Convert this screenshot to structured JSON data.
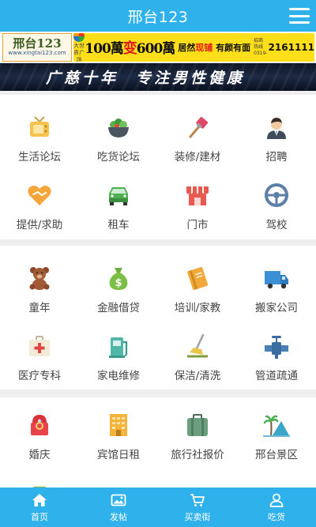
{
  "header": {
    "title": "邢台123",
    "menu_icon": "hamburger-menu-icon"
  },
  "ad_banner_1": {
    "logo_text": "邢台123",
    "logo_url_text": "www.xingtai123.com",
    "brand_text": "大世界广场",
    "slogan_a": "100萬",
    "slogan_b": "变",
    "slogan_c": "600萬",
    "sub_a": "居然",
    "sub_b": "现铺",
    "sub_c": "有颜有面",
    "hotline_label": "招商热线 0319-",
    "phone": "2161111"
  },
  "ad_banner_2": {
    "part1": "广慈十年",
    "part2": "专注男性健康"
  },
  "sections": [
    {
      "items": [
        {
          "label": "生活论坛",
          "icon": "tv-icon"
        },
        {
          "label": "吃货论坛",
          "icon": "salad-bowl-icon"
        },
        {
          "label": "装修/建材",
          "icon": "paint-brush-icon"
        },
        {
          "label": "招聘",
          "icon": "businessman-icon"
        },
        {
          "label": "提供/求助",
          "icon": "handshake-heart-icon"
        },
        {
          "label": "租车",
          "icon": "car-icon"
        },
        {
          "label": "门市",
          "icon": "storefront-icon"
        },
        {
          "label": "驾校",
          "icon": "steering-wheel-icon"
        }
      ]
    },
    {
      "items": [
        {
          "label": "童年",
          "icon": "teddy-bear-icon"
        },
        {
          "label": "金融借贷",
          "icon": "money-bag-icon"
        },
        {
          "label": "培训/家教",
          "icon": "notebook-icon"
        },
        {
          "label": "搬家公司",
          "icon": "truck-icon"
        },
        {
          "label": "医疗专科",
          "icon": "first-aid-kit-icon"
        },
        {
          "label": "家电维修",
          "icon": "gas-pump-icon"
        },
        {
          "label": "保洁/清洗",
          "icon": "broom-icon"
        },
        {
          "label": "管道疏通",
          "icon": "pipe-valve-icon"
        }
      ]
    },
    {
      "items": [
        {
          "label": "婚庆",
          "icon": "ring-box-icon"
        },
        {
          "label": "宾馆日租",
          "icon": "hotel-building-icon"
        },
        {
          "label": "旅行社报价",
          "icon": "suitcase-icon"
        },
        {
          "label": "邢台景区",
          "icon": "palm-mountain-icon"
        }
      ]
    }
  ],
  "bottom_nav": [
    {
      "label": "首页",
      "icon": "home-icon"
    },
    {
      "label": "发帖",
      "icon": "image-post-icon"
    },
    {
      "label": "买卖街",
      "icon": "shopping-cart-icon"
    },
    {
      "label": "吃货",
      "icon": "user-icon"
    }
  ],
  "colors": {
    "primary": "#2fb2ec",
    "text": "#444444",
    "background": "#efefef"
  }
}
